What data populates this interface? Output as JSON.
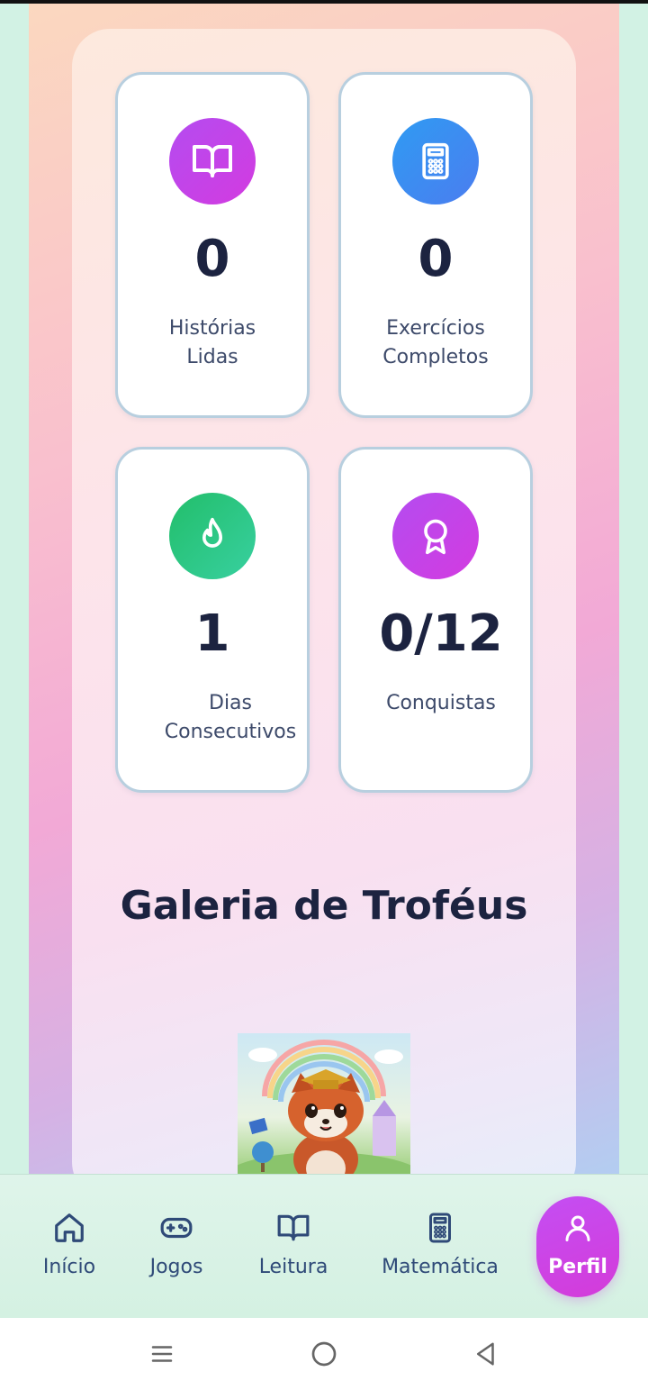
{
  "stats": [
    {
      "value": "0",
      "label": "Histórias\nLidas",
      "icon": "book-open-icon",
      "color": "#c248ec"
    },
    {
      "value": "0",
      "label": "Exercícios\nCompletos",
      "icon": "calculator-icon",
      "color": "#3a8cf3"
    },
    {
      "value": "1",
      "label": "Dias\nConsecutivos",
      "icon": "flame-icon",
      "color": "#2ac67f"
    },
    {
      "value": "0/12",
      "label": "Conquistas",
      "icon": "award-icon",
      "color": "#c248ec"
    }
  ],
  "gallery": {
    "title": "Galeria de Troféus",
    "image_desc_icon": "red-panda-graduate-image"
  },
  "bottom_nav": {
    "items": [
      {
        "label": "Início",
        "icon": "home-icon"
      },
      {
        "label": "Jogos",
        "icon": "gamepad-icon"
      },
      {
        "label": "Leitura",
        "icon": "book-open-icon"
      },
      {
        "label": "Matemática",
        "icon": "calculator-icon"
      },
      {
        "label": "Perfil",
        "icon": "user-icon",
        "active": true
      }
    ]
  },
  "system_nav": {
    "icons": [
      "menu-icon",
      "home-circle-icon",
      "back-icon"
    ]
  }
}
